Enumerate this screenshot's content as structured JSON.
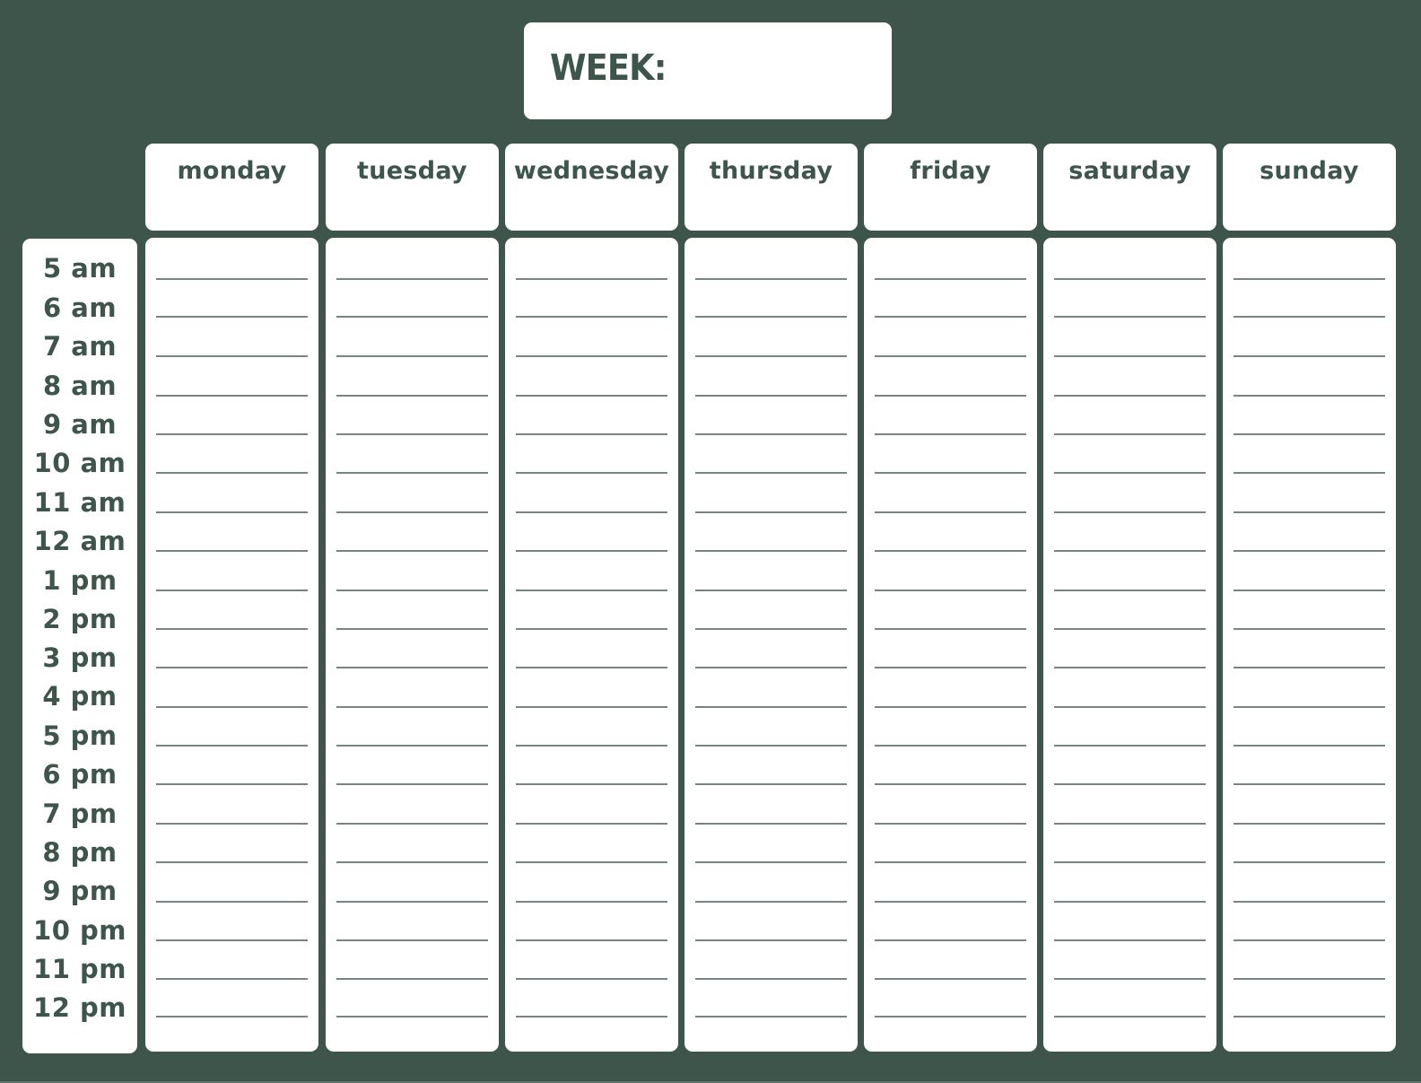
{
  "title": "WEEK:",
  "days": [
    "monday",
    "tuesday",
    "wednesday",
    "thursday",
    "friday",
    "saturday",
    "sunday"
  ],
  "times": [
    "5 am",
    "6 am",
    "7 am",
    "8 am",
    "9 am",
    "10 am",
    "11 am",
    "12 am",
    "1 pm",
    "2 pm",
    "3 pm",
    "4 pm",
    "5 pm",
    "6 pm",
    "7 pm",
    "8 pm",
    "9 pm",
    "10 pm",
    "11 pm",
    "12 pm"
  ],
  "colors": {
    "background": "#3d554b",
    "text": "#3d554b",
    "panel": "#ffffff",
    "line": "#76857f"
  }
}
